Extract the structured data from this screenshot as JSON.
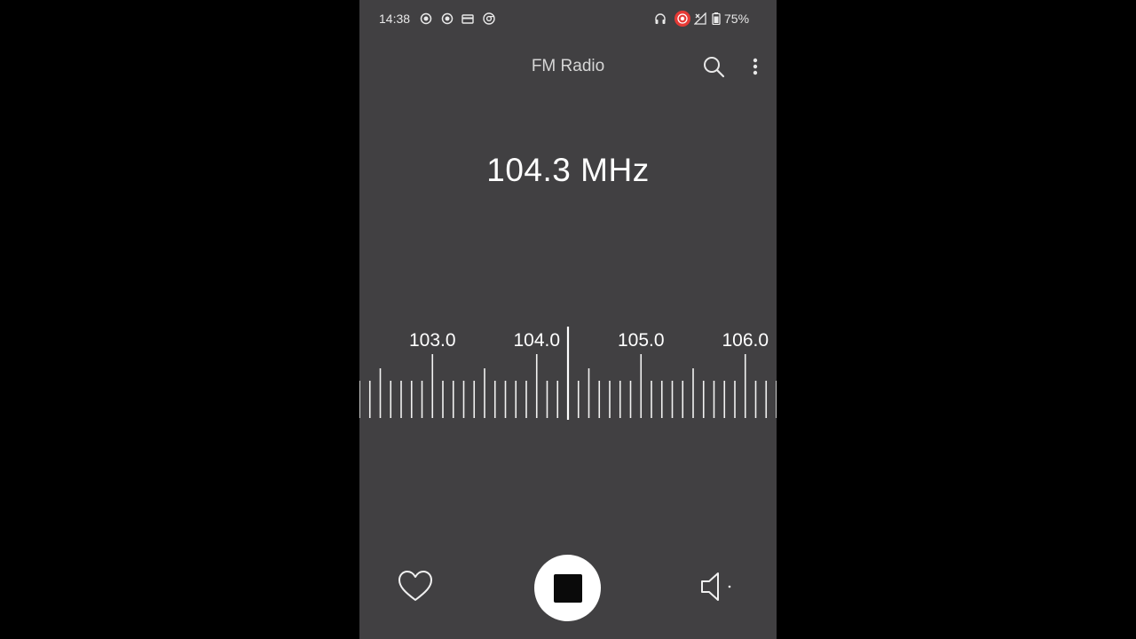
{
  "status_bar": {
    "time": "14:38",
    "battery": "75%",
    "left_icons": [
      "record-icon",
      "record-icon",
      "card-icon",
      "chrome-icon"
    ],
    "right_icons": [
      "headphones-icon",
      "recording-indicator-icon",
      "no-signal-icon",
      "battery-icon"
    ],
    "recording_color": "#e53935"
  },
  "app_bar": {
    "title": "FM Radio",
    "search_icon": "search-icon",
    "more_icon": "more-vertical-icon"
  },
  "tuner": {
    "frequency_display": "104.3 MHz",
    "current_mhz": 104.3,
    "scale_labels": [
      "103.0",
      "104.0",
      "105.0",
      "106.0"
    ],
    "scale_values": [
      103.0,
      104.0,
      105.0,
      106.0
    ]
  },
  "controls": {
    "favorite_icon": "heart-outline-icon",
    "stop_icon": "stop-icon",
    "speaker_icon": "speaker-icon"
  },
  "colors": {
    "background": "#414042",
    "text": "#ffffff",
    "title": "#d6d6d6"
  }
}
